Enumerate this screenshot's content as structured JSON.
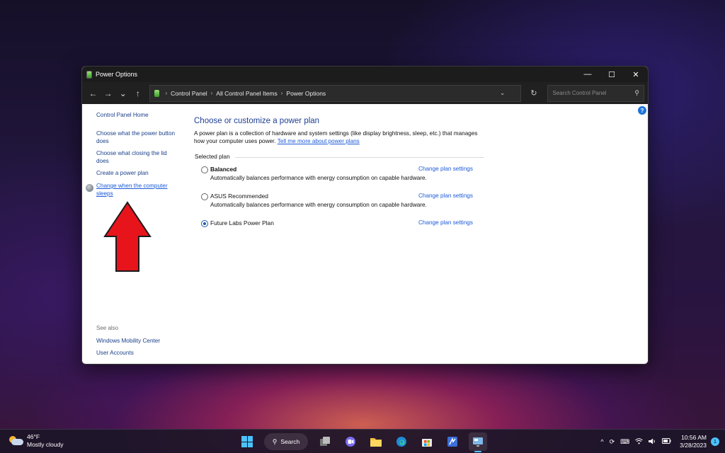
{
  "window": {
    "title": "Power Options",
    "controls": {
      "minimize": "—",
      "maximize": "☐",
      "close": "✕"
    }
  },
  "addressbar": {
    "back": "←",
    "forward": "→",
    "recent": "⌄",
    "up": "↑",
    "breadcrumbs": [
      "Control Panel",
      "All Control Panel Items",
      "Power Options"
    ],
    "separator": "›",
    "dropdown": "⌄",
    "refresh": "↻",
    "search_placeholder": "Search Control Panel"
  },
  "left_pane": {
    "home": "Control Panel Home",
    "links": [
      "Choose what the power button does",
      "Choose what closing the lid does",
      "Create a power plan",
      "Change when the computer sleeps"
    ],
    "see_also_heading": "See also",
    "see_also": [
      "Windows Mobility Center",
      "User Accounts"
    ]
  },
  "main": {
    "title": "Choose or customize a power plan",
    "description": "A power plan is a collection of hardware and system settings (like display brightness, sleep, etc.) that manages how your computer uses power.",
    "learn_more": "Tell me more about power plans",
    "group_label": "Selected plan",
    "help": "?",
    "plans": [
      {
        "name": "Balanced",
        "description": "Automatically balances performance with energy consumption on capable hardware.",
        "change": "Change plan settings",
        "selected": false
      },
      {
        "name": "ASUS Recommended",
        "description": "Automatically balances performance with energy consumption on capable hardware.",
        "change": "Change plan settings",
        "selected": false
      },
      {
        "name": "Future Labs Power Plan",
        "description": "",
        "change": "Change plan settings",
        "selected": true
      }
    ]
  },
  "taskbar": {
    "weather": {
      "temp": "46°F",
      "condition": "Mostly cloudy"
    },
    "search_label": "Search",
    "clock": {
      "time": "10:56 AM",
      "date": "3/28/2023"
    },
    "notification_count": "1",
    "tray_chevron": "^"
  },
  "colors": {
    "link": "#1b5ad8",
    "title": "#1e3f94",
    "accent": "#4cc2ff",
    "arrow": "#e8141c"
  }
}
